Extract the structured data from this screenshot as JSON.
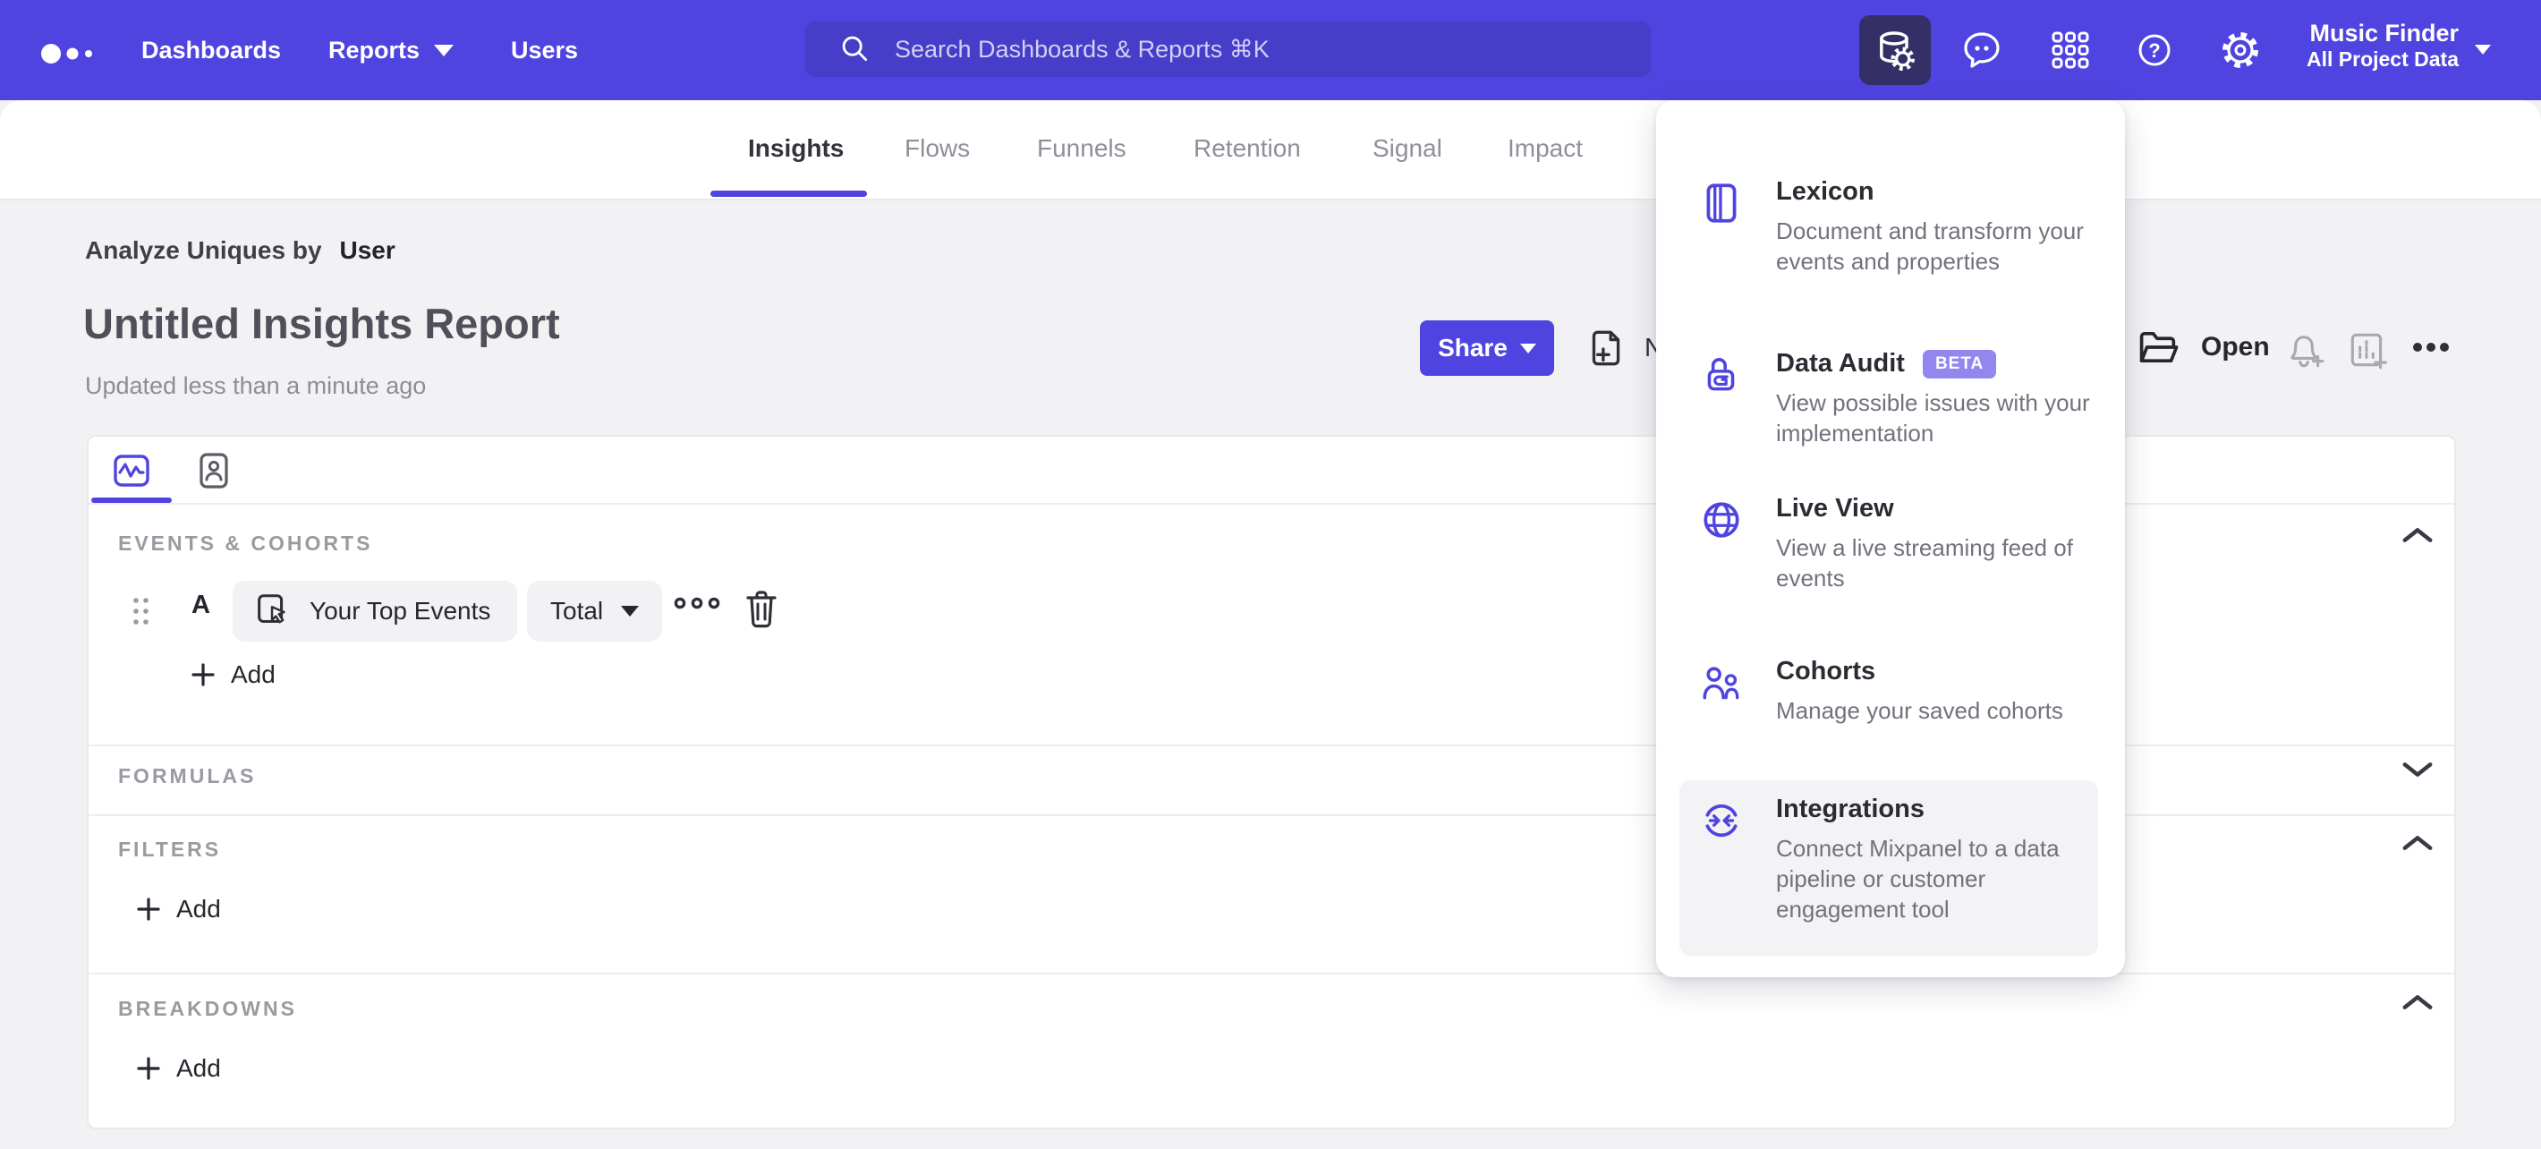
{
  "colors": {
    "accent": "#4f44e0",
    "nav_background": "#4f44e0",
    "search_background": "#463dc8",
    "active_tile_background": "#352f68",
    "beta_badge": "#9287ef",
    "page_background": "#f2f2f4"
  },
  "nav": {
    "items": [
      {
        "label": "Dashboards"
      },
      {
        "label": "Reports"
      },
      {
        "label": "Users"
      }
    ],
    "search": {
      "placeholder": "Search Dashboards & Reports ⌘K"
    },
    "help_glyph": "?",
    "project": {
      "name": "Music Finder",
      "scope": "All Project Data"
    }
  },
  "tabs": {
    "items": [
      {
        "label": "Insights",
        "active": true
      },
      {
        "label": "Flows"
      },
      {
        "label": "Funnels"
      },
      {
        "label": "Retention"
      },
      {
        "label": "Signal"
      },
      {
        "label": "Impact"
      }
    ]
  },
  "report": {
    "analyze_label": "Analyze Uniques by",
    "analyze_value": "User",
    "title": "Untitled Insights Report",
    "updated": "Updated less than a minute ago",
    "share_label": "Share",
    "new_label": "New",
    "open_label": "Open"
  },
  "builder": {
    "events_label": "EVENTS & COHORTS",
    "formulas_label": "FORMULAS",
    "filters_label": "FILTERS",
    "breakdowns_label": "BREAKDOWNS",
    "row": {
      "letter": "A",
      "event": "Your Top Events",
      "metric": "Total"
    },
    "add_label": "Add"
  },
  "menu": {
    "items": [
      {
        "title": "Lexicon",
        "description": "Document and transform your events and properties"
      },
      {
        "title": "Data Audit",
        "badge": "BETA",
        "description": "View possible issues with your implementation"
      },
      {
        "title": "Live View",
        "description": "View a live streaming feed of events"
      },
      {
        "title": "Cohorts",
        "description": "Manage your saved cohorts"
      },
      {
        "title": "Integrations",
        "description": "Connect Mixpanel to a data pipeline or customer engagement tool",
        "highlighted": true
      }
    ]
  }
}
